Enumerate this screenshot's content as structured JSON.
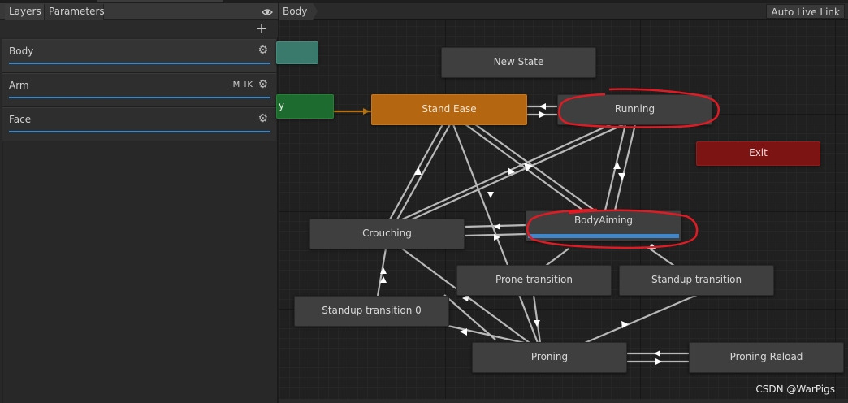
{
  "left_panel": {
    "tabs": [
      "Layers",
      "Parameters"
    ],
    "eye_icon": "eye-icon",
    "add_icon": "plus-icon",
    "layers": [
      {
        "name": "Body",
        "flags": "",
        "selected": true
      },
      {
        "name": "Arm",
        "flags": "M IK",
        "selected": false
      },
      {
        "name": "Face",
        "flags": "",
        "selected": false
      }
    ]
  },
  "graph": {
    "breadcrumb": "Body",
    "auto_live_link": "Auto Live Link",
    "states": {
      "new_state": "New State",
      "stand_ease": "Stand Ease",
      "running": "Running",
      "exit": "Exit",
      "entry": "y",
      "crouching": "Crouching",
      "body_aiming": "BodyAiming",
      "prone_transition": "Prone transition",
      "standup_transition": "Standup transition",
      "standup_transition_0": "Standup transition 0",
      "proning": "Proning",
      "proning_reload": "Proning Reload"
    },
    "body_aiming_progress": 1.0,
    "colors": {
      "default_state": "#3f3f3f",
      "default_state_orange": "#b56610",
      "entry_green": "#1e6b2f",
      "any_state_teal": "#3a7a6d",
      "exit_red": "#7d1414",
      "annotation_red": "#e01b24",
      "progress_blue": "#3d87cf"
    }
  },
  "watermark": "CSDN @WarPigs"
}
